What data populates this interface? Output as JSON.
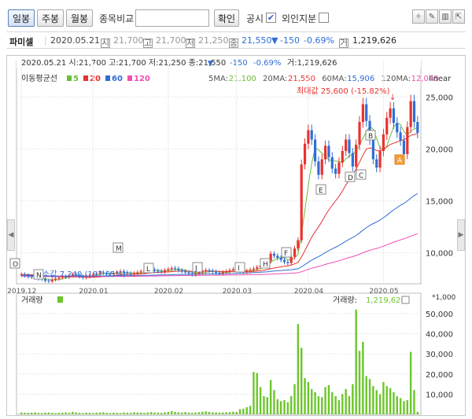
{
  "toolbar": {
    "daily_label": "일봉",
    "weekly_label": "주봉",
    "monthly_label": "월봉",
    "compare_label": "종목비교",
    "compare_value": "",
    "confirm_label": "확인",
    "disclosure_label": "공시",
    "disclosure_checked": "✔",
    "foreign_label": "외인지분",
    "tool_icons": [
      "lightbulb-icon",
      "edit-icon",
      "layout-icon",
      "export-icon"
    ]
  },
  "stock": {
    "name": "파미셀",
    "date": "2020.05.21",
    "open_icon": "시",
    "open": "21,700",
    "high_icon": "고",
    "high": "21,700",
    "low_icon": "저",
    "low": "21,250",
    "close_icon": "종",
    "close": "21,550",
    "change_arrow": "▼",
    "change": "-150",
    "change_pct": "-0.69%",
    "volume_icon": "거",
    "volume": "1,219,626"
  },
  "chart_header": {
    "line1_prefix": "2020.05.21 시:21,700 고:21,700 저:21,250 종:21,550",
    "line1_arrow": "▼",
    "line1_change": "-150",
    "line1_pct": "-0.69%",
    "line1_volume": "거:1,219,626",
    "ma_title": "이동평균선",
    "ma_periods": [
      "5",
      "20",
      "60",
      "120"
    ],
    "ma_values": [
      {
        "label": "5MA:",
        "value": "21,100"
      },
      {
        "label": "20MA:",
        "value": "21,550"
      },
      {
        "label": "60MA:",
        "value": "15,906"
      },
      {
        "label": "120MA:",
        "value": "12,048"
      }
    ],
    "scale_label": "linear",
    "max_annotation": "최대값 25,600 (-15.82%)",
    "min_annotation": "최소값 7,240 (197.65%)"
  },
  "colors": {
    "up": "#e8322f",
    "down": "#2f6ed6",
    "ma5": "#6bbd3b",
    "ma20": "#e8322f",
    "ma60": "#2f6ed6",
    "ma120": "#f04fb4",
    "volume": "#6cc62b"
  },
  "volume_header": {
    "title": "거래량",
    "value_label": "거래량:",
    "value": "1,219,626",
    "unit_label": "*1,000"
  },
  "event_markers": [
    "O",
    "N",
    "M",
    "L",
    "J",
    "I",
    "H",
    "F",
    "E",
    "D",
    "C",
    "B",
    "A"
  ],
  "chart_data": [
    {
      "type": "candlestick",
      "title": "",
      "x": [
        "2019.12",
        "2020.01",
        "2020.02",
        "2020.03",
        "2020.04",
        "2020.05"
      ],
      "ylim": [
        7000,
        27000
      ],
      "yticks": [
        10000,
        15000,
        20000,
        25000
      ],
      "ytick_labels": [
        "10,000",
        "15,000",
        "20,000",
        "25,000"
      ],
      "grid": true,
      "close_series": [
        7900,
        7800,
        7700,
        7650,
        7600,
        7500,
        7450,
        7300,
        7240,
        7400,
        7500,
        7600,
        7700,
        7650,
        7800,
        7900,
        7850,
        7700,
        7600,
        7700,
        7800,
        7900,
        8000,
        8100,
        8050,
        7950,
        7900,
        8000,
        8100,
        8200,
        8100,
        8000,
        7900,
        8000,
        8100,
        8200,
        8300,
        8400,
        8350,
        8250,
        8200,
        8150,
        8300,
        8400,
        8500,
        8450,
        8300,
        8200,
        8100,
        8000,
        7900,
        8000,
        8100,
        8200,
        8300,
        8250,
        8150,
        8050,
        8000,
        8100,
        8200,
        8300,
        8400,
        8350,
        8250,
        8150,
        8250,
        8350,
        8450,
        8600,
        8750,
        8900,
        9200,
        9900,
        9700,
        9500,
        9300,
        9100,
        9000,
        9600,
        10400,
        11200,
        18500,
        20500,
        21800,
        20900,
        18800,
        17500,
        19000,
        20300,
        19200,
        18100,
        17600,
        18700,
        19800,
        20900,
        19600,
        18300,
        20400,
        22600,
        24300,
        22700,
        20900,
        19000,
        18200,
        19800,
        21400,
        23000,
        23900,
        22500,
        21600,
        20800,
        19500,
        22100,
        24600,
        22600,
        21550
      ],
      "ma_series": {
        "MA5": "5-day moving average, latest 21,100",
        "MA20": "20-day moving average, latest 21,550",
        "MA60": "60-day moving average, latest 15,906",
        "MA120": "120-day moving average, latest 12,048"
      },
      "max_point": {
        "value": 25600,
        "pct": "-15.82%"
      },
      "min_point": {
        "value": 7240,
        "pct": "197.65%"
      }
    },
    {
      "type": "bar",
      "title": "거래량",
      "unit": "*1,000",
      "ylim": [
        0,
        57000
      ],
      "yticks": [
        10000,
        20000,
        30000,
        40000,
        50000
      ],
      "ytick_labels": [
        "10,000",
        "20,000",
        "30,000",
        "40,000",
        "50,000"
      ],
      "values": [
        900,
        800,
        700,
        800,
        900,
        700,
        600,
        800,
        900,
        700,
        600,
        700,
        800,
        900,
        700,
        1200,
        900,
        700,
        600,
        800,
        700,
        600,
        800,
        900,
        1000,
        700,
        600,
        800,
        700,
        600,
        900,
        800,
        700,
        1000,
        900,
        800,
        700,
        900,
        1100,
        900,
        800,
        700,
        1000,
        1200,
        1600,
        1200,
        1000,
        900,
        1100,
        800,
        700,
        900,
        1000,
        1300,
        1500,
        1200,
        1000,
        900,
        800,
        900,
        1000,
        1100,
        1300,
        1200,
        2500,
        2800,
        3500,
        4200,
        21000,
        20500,
        13500,
        9000,
        8500,
        17000,
        12000,
        7500,
        6500,
        7000,
        6000,
        9000,
        15000,
        44800,
        33000,
        18000,
        16000,
        12500,
        11000,
        9000,
        8500,
        13500,
        14500,
        11000,
        9000,
        7000,
        10000,
        12500,
        9000,
        15000,
        52000,
        31500,
        36000,
        19000,
        17500,
        14000,
        12000,
        10000,
        16000,
        14000,
        13000,
        11000,
        9000,
        8000,
        6500,
        7000,
        31000,
        12000,
        1219
      ]
    }
  ]
}
